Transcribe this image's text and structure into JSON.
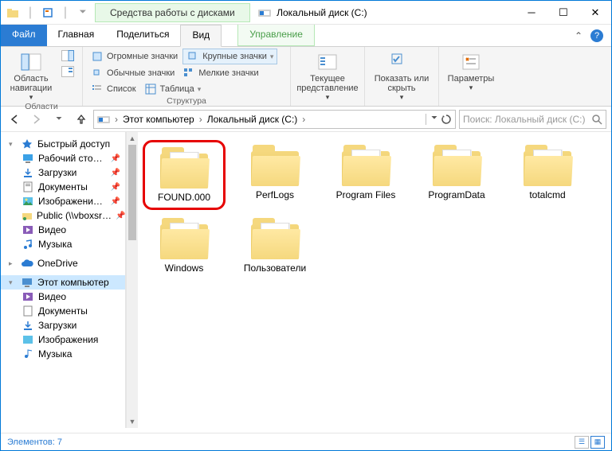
{
  "title_bar": {
    "context_tab": "Средства работы с дисками",
    "window_title": "Локальный диск (C:)"
  },
  "tabs": {
    "file": "Файл",
    "home": "Главная",
    "share": "Поделиться",
    "view": "Вид",
    "manage": "Управление"
  },
  "ribbon": {
    "nav_pane": "Область навигации",
    "nav_group": "Области",
    "layout_group": "Структура",
    "icons_xl": "Огромные значки",
    "icons_lg": "Крупные значки",
    "icons_md": "Обычные значки",
    "icons_sm": "Мелкие значки",
    "list": "Список",
    "table": "Таблица",
    "current_view": "Текущее представление",
    "show_hide": "Показать или скрыть",
    "options": "Параметры"
  },
  "breadcrumb": {
    "pc": "Этот компьютер",
    "drive": "Локальный диск (C:)"
  },
  "search": {
    "placeholder": "Поиск: Локальный диск (C:)"
  },
  "sidebar": {
    "quick": "Быстрый доступ",
    "desktop": "Рабочий сто…",
    "downloads": "Загрузки",
    "documents": "Документы",
    "pictures": "Изображени…",
    "public": "Public (\\\\vboxsr…",
    "videos": "Видео",
    "music": "Музыка",
    "onedrive": "OneDrive",
    "thispc": "Этот компьютер",
    "pc_videos": "Видео",
    "pc_documents": "Документы",
    "pc_downloads": "Загрузки",
    "pc_pictures": "Изображения",
    "pc_music": "Музыка"
  },
  "folders": {
    "found": "FOUND.000",
    "perflogs": "PerfLogs",
    "programfiles": "Program Files",
    "programdata": "ProgramData",
    "totalcmd": "totalcmd",
    "windows": "Windows",
    "users": "Пользователи"
  },
  "status": {
    "count_label": "Элементов:",
    "count": "7"
  }
}
